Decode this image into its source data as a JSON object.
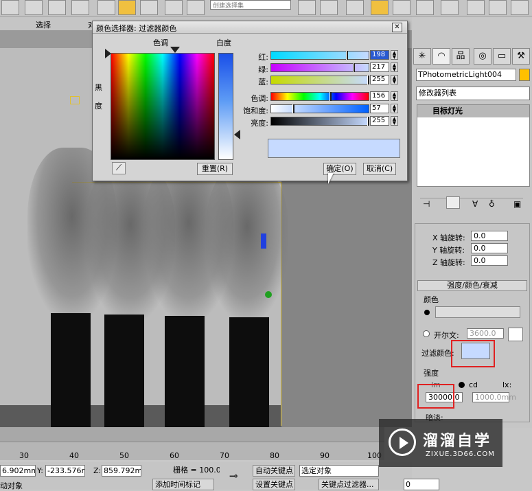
{
  "toolbar": {
    "selection_set_placeholder": "创建选择集"
  },
  "menu": {
    "select_label": "选择",
    "truncated_label": "对"
  },
  "dialog": {
    "title": "颜色选择器: 过滤器颜色",
    "close_label": "✕",
    "hue_label": "色调",
    "whiteness_label": "白度",
    "black_label": "黑",
    "degree_label": "度",
    "reset_label": "重置(R)",
    "ok_label": "确定(O)",
    "cancel_label": "取消(C)",
    "sliders": [
      {
        "label": "红:",
        "value": "198",
        "fraction": 0.78
      },
      {
        "label": "绿:",
        "value": "217",
        "fraction": 0.85
      },
      {
        "label": "蓝:",
        "value": "255",
        "fraction": 1.0
      },
      {
        "label": "色调:",
        "value": "156",
        "fraction": 0.61
      },
      {
        "label": "饱和度:",
        "value": "57",
        "fraction": 0.22
      },
      {
        "label": "亮度:",
        "value": "255",
        "fraction": 1.0
      }
    ],
    "preview_color": "#c6daff"
  },
  "command_panel": {
    "object_name": "TPhotometricLight004",
    "object_color": "#ffc000",
    "modifier_list_label": "修改器列表",
    "modifier_stack_item": "目标灯光",
    "rotation_fields": [
      {
        "label": "X 轴旋转:",
        "value": "0.0"
      },
      {
        "label": "Y 轴旋转:",
        "value": "0.0"
      },
      {
        "label": "Z 轴旋转:",
        "value": "0.0"
      }
    ],
    "rollout_title": "强度/颜色/衰减",
    "color_group_label": "颜色",
    "kelvin_label": "开尔文:",
    "kelvin_value": "3600.0",
    "filter_color_label": "过滤颜色:",
    "filter_color": "#c6daff",
    "intensity_group_label": "强度",
    "units": [
      "lm",
      "cd",
      "lx:"
    ],
    "intensity_value": "30000.0",
    "lx_value": "1000.0mm",
    "dimming_label": "暗淡:"
  },
  "timeline": {
    "ticks": [
      "30",
      "40",
      "50",
      "60",
      "70",
      "80",
      "90",
      "100"
    ]
  },
  "status": {
    "x_value": "6.902mm",
    "y_label": "Y:",
    "y_value": "-233.576m",
    "z_label": "Z:",
    "z_value": "859.792mm",
    "grid_label": "栅格 = 100.0mm",
    "auto_key_label": "自动关键点",
    "selected_object_label": "选定对象",
    "set_key_label": "设置关键点",
    "key_filter_label": "关键点过滤器...",
    "frame_value": "0",
    "add_time_tag_label": "添加时间标记",
    "left_status_text": "动对象"
  },
  "watermark": {
    "title": "溜溜自学",
    "url": "ZIXUE.3D66.COM"
  }
}
